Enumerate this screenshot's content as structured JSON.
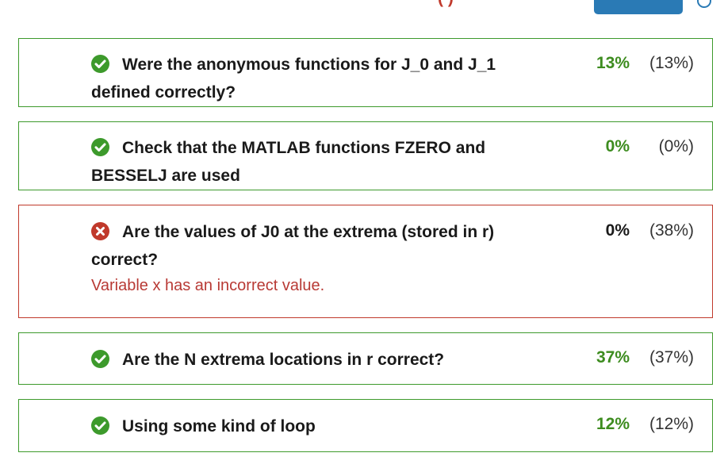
{
  "checks": [
    {
      "status": "pass",
      "text": "Were the anonymous functions for J_0 and J_1 defined correctly?",
      "score": "13%",
      "max": "(13%)"
    },
    {
      "status": "pass",
      "text": "Check that the MATLAB functions FZERO and BESSELJ are used",
      "score": "0%",
      "max": "(0%)"
    },
    {
      "status": "fail",
      "text": "Are the values of J0 at the extrema (stored in r) correct?",
      "error": "Variable x has an incorrect value.",
      "score": "0%",
      "max": "(38%)"
    },
    {
      "status": "pass",
      "text": "Are the N extrema locations in r correct?",
      "score": "37%",
      "max": "(37%)"
    },
    {
      "status": "pass",
      "text": "Using some kind of loop",
      "score": "12%",
      "max": "(12%)"
    }
  ],
  "colors": {
    "pass": "#3d9a2c",
    "fail": "#c0392b",
    "accent": "#2a7ab5"
  },
  "icons": {
    "pass": "check-circle-icon",
    "fail": "x-circle-icon"
  }
}
